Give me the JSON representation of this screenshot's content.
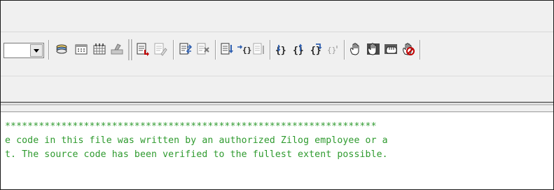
{
  "toolbar": {
    "combo_value": "",
    "icons": [
      "stack-icon",
      "calendar-icon",
      "calendar-grid-icon",
      "clear-icon",
      "document-arrow-icon",
      "document-pen-icon",
      "document-swap-icon",
      "document-x-icon",
      "step-into-icon",
      "step-braces-icon",
      "document-lines-icon",
      "step-over-braces-icon",
      "step-out-braces-icon",
      "run-to-braces-icon",
      "braces-dim-icon",
      "hand-icon",
      "hand-dark-icon",
      "hand-fist-icon",
      "hand-no-icon"
    ]
  },
  "editor": {
    "lines": [
      "******************************************************************",
      "e code in this file was written by an authorized Zilog employee or a",
      "t. The source code has been verified to the fullest extent possible.",
      "                                                                   "
    ],
    "text_color": "#2e9a2e"
  }
}
